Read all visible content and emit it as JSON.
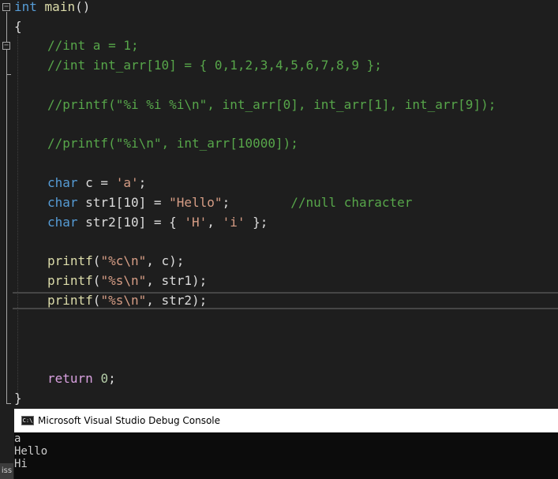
{
  "editor": {
    "lines": {
      "l1": {
        "type": "int",
        "name": "main",
        "rest": "()"
      },
      "l2": {
        "brace": "{"
      },
      "l3": {
        "comment": "//int a = 1;"
      },
      "l4": {
        "comment": "//int int_arr[10] = { 0,1,2,3,4,5,6,7,8,9 };"
      },
      "l5": {
        "comment": "//printf(\"%i %i %i\\n\", int_arr[0], int_arr[1], int_arr[9]);"
      },
      "l6": {
        "comment": "//printf(\"%i\\n\", int_arr[10000]);"
      },
      "l7": {
        "type": "char",
        "decl": " c = ",
        "value": "'a'",
        "end": ";"
      },
      "l8": {
        "type": "char",
        "decl": " str1[10] = ",
        "value": "\"Hello\"",
        "end": ";",
        "gap": "        ",
        "comment": "//null character"
      },
      "l9": {
        "type": "char",
        "decl": " str2[10] = { ",
        "v1": "'H'",
        "sep": ", ",
        "v2": "'i'",
        "end": " };"
      },
      "l10": {
        "fn": "printf",
        "open": "(",
        "fmt": "\"%c\\n\"",
        "args": ", c);"
      },
      "l11": {
        "fn": "printf",
        "open": "(",
        "fmt": "\"%s\\n\"",
        "args": ", str1);"
      },
      "l12": {
        "fn": "printf",
        "open": "(",
        "fmt": "\"%s\\n\"",
        "args": ", str2);"
      },
      "l13": {
        "kw": "return",
        "sp": " ",
        "num": "0",
        "end": ";"
      },
      "l14": {
        "brace": "}"
      }
    }
  },
  "console": {
    "title": "Microsoft Visual Studio Debug Console",
    "icon": "C:\\",
    "output": [
      "a",
      "Hello",
      "Hi"
    ]
  },
  "side_tab": {
    "label": "iss"
  },
  "colors": {
    "keyword": "#569cd6",
    "control_keyword": "#d8a0df",
    "function": "#dcdcaa",
    "string": "#d69d85",
    "comment": "#57a64a",
    "number": "#b5cea8",
    "background": "#1e1e1e"
  }
}
